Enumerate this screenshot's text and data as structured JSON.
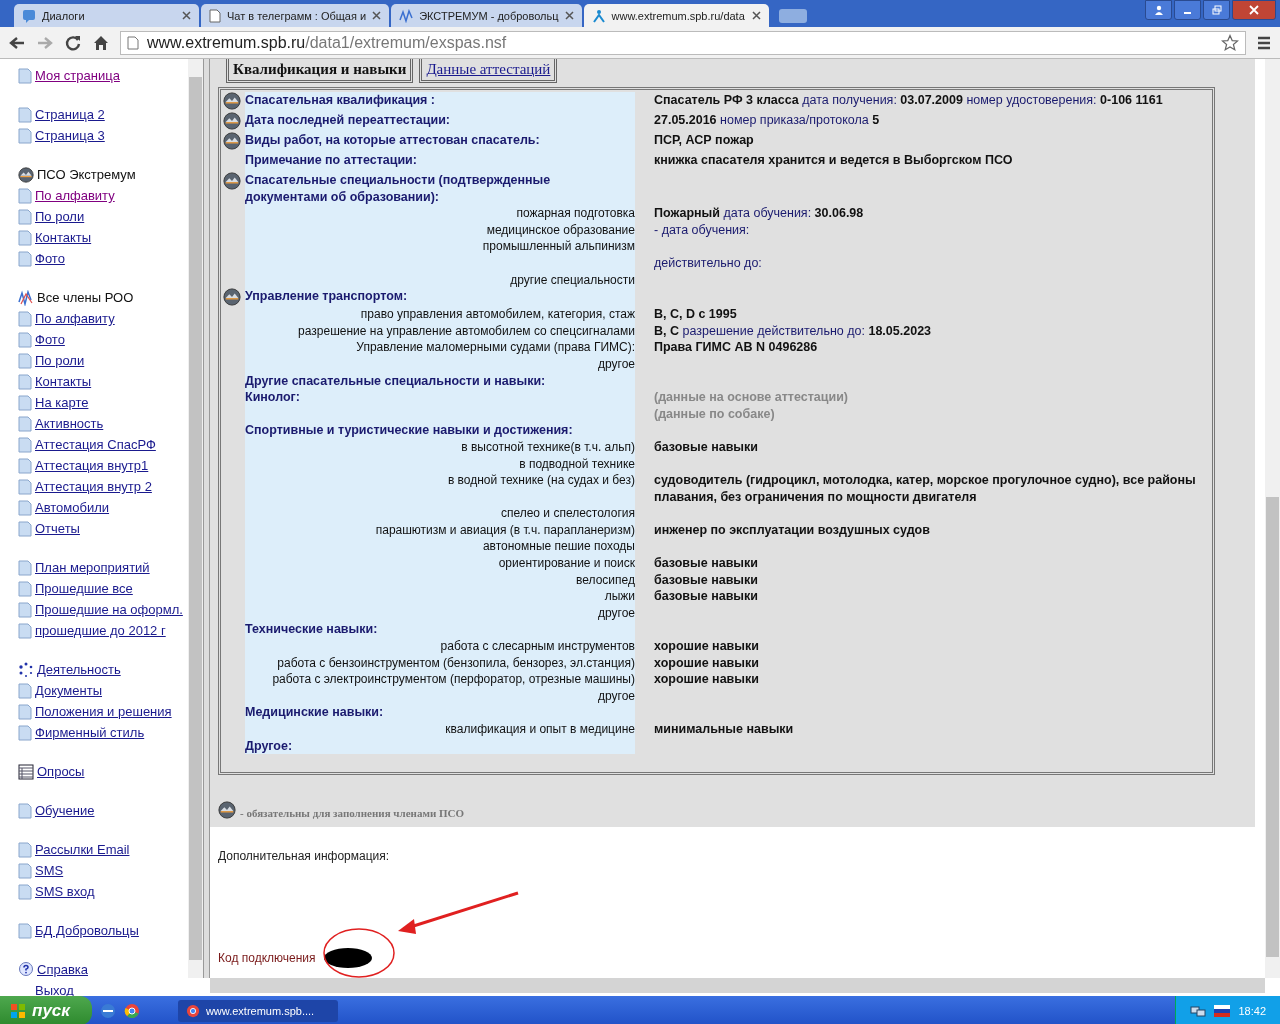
{
  "browser": {
    "tabs": [
      {
        "title": "Диалоги",
        "selected": false
      },
      {
        "title": "Чат в телеграмм : Общая и",
        "selected": false
      },
      {
        "title": "ЭКСТРЕМУМ - добровольц",
        "selected": false
      },
      {
        "title": "www.extremum.spb.ru/data",
        "selected": true
      }
    ],
    "address": {
      "host": "www.extremum.spb.ru",
      "path": "/data1/extremum/exspas.nsf"
    }
  },
  "sidebar": {
    "groups": [
      [
        {
          "label": "Моя страница",
          "kind": "page-link",
          "visited": true
        }
      ],
      [
        {
          "label": "Страница 2",
          "kind": "page-link",
          "visited": false
        },
        {
          "label": "Страница 3",
          "kind": "page-link",
          "visited": false
        }
      ],
      [
        {
          "label": "ПСО Экстремум",
          "kind": "emblem-heading"
        },
        {
          "label": "По алфавиту",
          "kind": "page-link",
          "visited": true
        },
        {
          "label": "По роли",
          "kind": "page-link",
          "visited": false
        },
        {
          "label": "Контакты",
          "kind": "page-link",
          "visited": false
        },
        {
          "label": "Фото",
          "kind": "page-link",
          "visited": false
        }
      ],
      [
        {
          "label": "Все члены РОО",
          "kind": "wave-heading"
        },
        {
          "label": "По алфавиту",
          "kind": "page-link",
          "visited": false
        },
        {
          "label": "Фото",
          "kind": "page-link",
          "visited": false
        },
        {
          "label": "По роли",
          "kind": "page-link",
          "visited": false
        },
        {
          "label": "Контакты",
          "kind": "page-link",
          "visited": false
        },
        {
          "label": "На карте",
          "kind": "page-link",
          "visited": false
        },
        {
          "label": "Активность",
          "kind": "page-link",
          "visited": false
        },
        {
          "label": "Аттестация СпасРФ",
          "kind": "page-link",
          "visited": false
        },
        {
          "label": "Аттестация внутр1",
          "kind": "page-link",
          "visited": false
        },
        {
          "label": "Аттестация внутр 2",
          "kind": "page-link",
          "visited": false
        },
        {
          "label": "Автомобили",
          "kind": "page-link",
          "visited": false
        },
        {
          "label": "Отчеты",
          "kind": "page-link",
          "visited": false
        }
      ],
      [
        {
          "label": "План мероприятий",
          "kind": "page-link",
          "visited": false
        },
        {
          "label": "Прошедшие все",
          "kind": "page-link",
          "visited": false
        },
        {
          "label": "Прошедшие на оформл.",
          "kind": "page-link",
          "visited": false
        },
        {
          "label": "прошедшие до 2012 г",
          "kind": "page-link",
          "visited": false
        }
      ],
      [
        {
          "label": "Деятельность",
          "kind": "dots-link",
          "visited": false
        },
        {
          "label": "Документы",
          "kind": "page-link",
          "visited": false
        },
        {
          "label": "Положения и решения",
          "kind": "page-link",
          "visited": false
        },
        {
          "label": "Фирменный стиль",
          "kind": "page-link",
          "visited": false
        }
      ],
      [
        {
          "label": "Опросы",
          "kind": "table-link",
          "visited": false
        }
      ],
      [
        {
          "label": "Обучение",
          "kind": "page-link",
          "visited": false
        }
      ],
      [
        {
          "label": "Рассылки Email",
          "kind": "page-link",
          "visited": false
        },
        {
          "label": "SMS",
          "kind": "page-link",
          "visited": false
        },
        {
          "label": "SMS вход",
          "kind": "page-link",
          "visited": false
        }
      ],
      [
        {
          "label": "БД Добровольцы",
          "kind": "page-link",
          "visited": false
        }
      ],
      [
        {
          "label": "Справка",
          "kind": "help-link",
          "visited": false
        },
        {
          "label": "Выход",
          "kind": "plain"
        }
      ]
    ]
  },
  "form_tabs": [
    {
      "label": "Квалификация и навыки",
      "selected": true
    },
    {
      "label": "Данные аттестаций",
      "selected": false
    }
  ],
  "rows": [
    {
      "kind": "section",
      "label": "Спасательная квалификация :",
      "required": true,
      "value": [
        {
          "kind": "value",
          "text": "Спасатель РФ 3 класса"
        },
        {
          "kind": "label",
          "text": "дата получения:"
        },
        {
          "kind": "value",
          "text": "03.07.2009"
        },
        {
          "kind": "label",
          "text": "номер удостоверения:"
        },
        {
          "kind": "value",
          "text": "0-106 1161"
        }
      ]
    },
    {
      "kind": "section",
      "label": "Дата последней переаттестации:",
      "required": true,
      "value": [
        {
          "kind": "value",
          "text": "27.05.2016"
        },
        {
          "kind": "label",
          "text": "номер приказа/протокола"
        },
        {
          "kind": "value",
          "text": "5"
        }
      ]
    },
    {
      "kind": "section",
      "label": "Виды работ, на которые аттестован спасатель:",
      "required": true,
      "value": [
        {
          "kind": "value",
          "text": "ПСР, АСР пожар"
        }
      ]
    },
    {
      "kind": "section",
      "label": "Примечание по аттестации:",
      "required": false,
      "value": [
        {
          "kind": "value",
          "text": "книжка спасателя хранится и ведется в Выборгском ПСО"
        }
      ]
    },
    {
      "kind": "section",
      "label": "Спасательные специальности (подтвержденные документами об образовании):",
      "required": true,
      "value": []
    },
    {
      "kind": "sub",
      "label": "пожарная подготовка",
      "required": false,
      "value": [
        {
          "kind": "value",
          "text": "Пожарный"
        },
        {
          "kind": "label",
          "text": "дата обучения:"
        },
        {
          "kind": "value",
          "text": "30.06.98"
        }
      ]
    },
    {
      "kind": "sub",
      "label": "медицинское образование",
      "required": false,
      "value": [
        {
          "kind": "label",
          "text": "- дата обучения:"
        }
      ]
    },
    {
      "kind": "sub",
      "label": "промышленный альпинизм",
      "required": false,
      "value": []
    },
    {
      "kind": "blank",
      "required": false,
      "value": [
        {
          "kind": "label",
          "text": "действительно до:"
        }
      ]
    },
    {
      "kind": "sub",
      "label": "другие специальности",
      "required": false,
      "value": []
    },
    {
      "kind": "section",
      "label": "Управление транспортом:",
      "required": true,
      "value": []
    },
    {
      "kind": "sub",
      "label": "право управления автомобилем, категория, стаж",
      "required": false,
      "value": [
        {
          "kind": "value",
          "text": "B, C, D с 1995"
        }
      ]
    },
    {
      "kind": "sub",
      "label": "разрешение на управление автомобилем со спецсигналами",
      "required": false,
      "value": [
        {
          "kind": "value",
          "text": "B, C"
        },
        {
          "kind": "label",
          "text": "разрешение действительно до:"
        },
        {
          "kind": "value",
          "text": "18.05.2023"
        }
      ]
    },
    {
      "kind": "sub",
      "label": "Управление маломерными судами (права ГИМС):",
      "required": false,
      "value": [
        {
          "kind": "value",
          "text": "Права ГИМС АВ N 0496286"
        }
      ]
    },
    {
      "kind": "sub",
      "label": "другое",
      "required": false,
      "value": []
    },
    {
      "kind": "section",
      "label": "Другие спасательные специальности и навыки:",
      "required": false,
      "value": []
    },
    {
      "kind": "section",
      "label": "Кинолог:",
      "required": false,
      "value": [
        {
          "kind": "hint",
          "text": "(данные на основе аттестации)"
        }
      ]
    },
    {
      "kind": "blank",
      "required": false,
      "value": [
        {
          "kind": "hint",
          "text": "(данные по собаке)"
        }
      ]
    },
    {
      "kind": "section",
      "label": "Спортивные и туристические навыки и достижения:",
      "required": false,
      "value": []
    },
    {
      "kind": "sub",
      "label": "в высотной технике(в т.ч. альп)",
      "required": false,
      "value": [
        {
          "kind": "value",
          "text": "базовые навыки"
        }
      ]
    },
    {
      "kind": "sub",
      "label": "в подводной технике",
      "required": false,
      "value": []
    },
    {
      "kind": "sub",
      "label": "в водной технике (на судах и без)",
      "required": false,
      "value": [
        {
          "kind": "value",
          "text": "судоводитель (гидроцикл, мотолодка, катер, морское прогулочное судно), все районы плавания, без ограничения по мощности двигателя"
        }
      ]
    },
    {
      "kind": "sub",
      "label": "спелео и спелестология",
      "required": false,
      "value": []
    },
    {
      "kind": "sub",
      "label": "парашютизм и авиация (в т.ч. парапланеризм)",
      "required": false,
      "value": [
        {
          "kind": "value",
          "text": "инженер по эксплуатации воздушных судов"
        }
      ]
    },
    {
      "kind": "sub",
      "label": "автономные пешие походы",
      "required": false,
      "value": []
    },
    {
      "kind": "sub",
      "label": "ориентирование и поиск",
      "required": false,
      "value": [
        {
          "kind": "value",
          "text": "базовые навыки"
        }
      ]
    },
    {
      "kind": "sub",
      "label": "велосипед",
      "required": false,
      "value": [
        {
          "kind": "value",
          "text": "базовые навыки"
        }
      ]
    },
    {
      "kind": "sub",
      "label": "лыжи",
      "required": false,
      "value": [
        {
          "kind": "value",
          "text": "базовые навыки"
        }
      ]
    },
    {
      "kind": "sub",
      "label": "другое",
      "required": false,
      "value": []
    },
    {
      "kind": "section",
      "label": "Технические навыки:",
      "required": false,
      "value": []
    },
    {
      "kind": "sub",
      "label": "работа с слесарным инструментов",
      "required": false,
      "value": [
        {
          "kind": "value",
          "text": "хорошие навыки"
        }
      ]
    },
    {
      "kind": "sub",
      "label": "работа с бензоинструментом (бензопила, бензорез, эл.станция)",
      "required": false,
      "value": [
        {
          "kind": "value",
          "text": "хорошие навыки"
        }
      ]
    },
    {
      "kind": "sub",
      "label": "работа с электроинструментом (перфоратор, отрезные машины)",
      "required": false,
      "value": [
        {
          "kind": "value",
          "text": "хорошие навыки"
        }
      ]
    },
    {
      "kind": "sub",
      "label": "другое",
      "required": false,
      "value": []
    },
    {
      "kind": "section",
      "label": "Медицинские навыки:",
      "required": false,
      "value": []
    },
    {
      "kind": "sub",
      "label": "квалификация и опыт в медицине",
      "required": false,
      "value": [
        {
          "kind": "value",
          "text": "минимальные навыки"
        }
      ]
    },
    {
      "kind": "section",
      "label": "Другое:",
      "required": false,
      "value": []
    }
  ],
  "legend": "- обязательны для заполнения членами ПСО",
  "extra_info_label": "Дополнительная информация:",
  "connection_code_label": "Код подключения",
  "taskbar": {
    "start": "пуск",
    "tasks": [
      {
        "title": "www.extremum.spb....",
        "selected": true
      }
    ],
    "clock": "18:42"
  }
}
